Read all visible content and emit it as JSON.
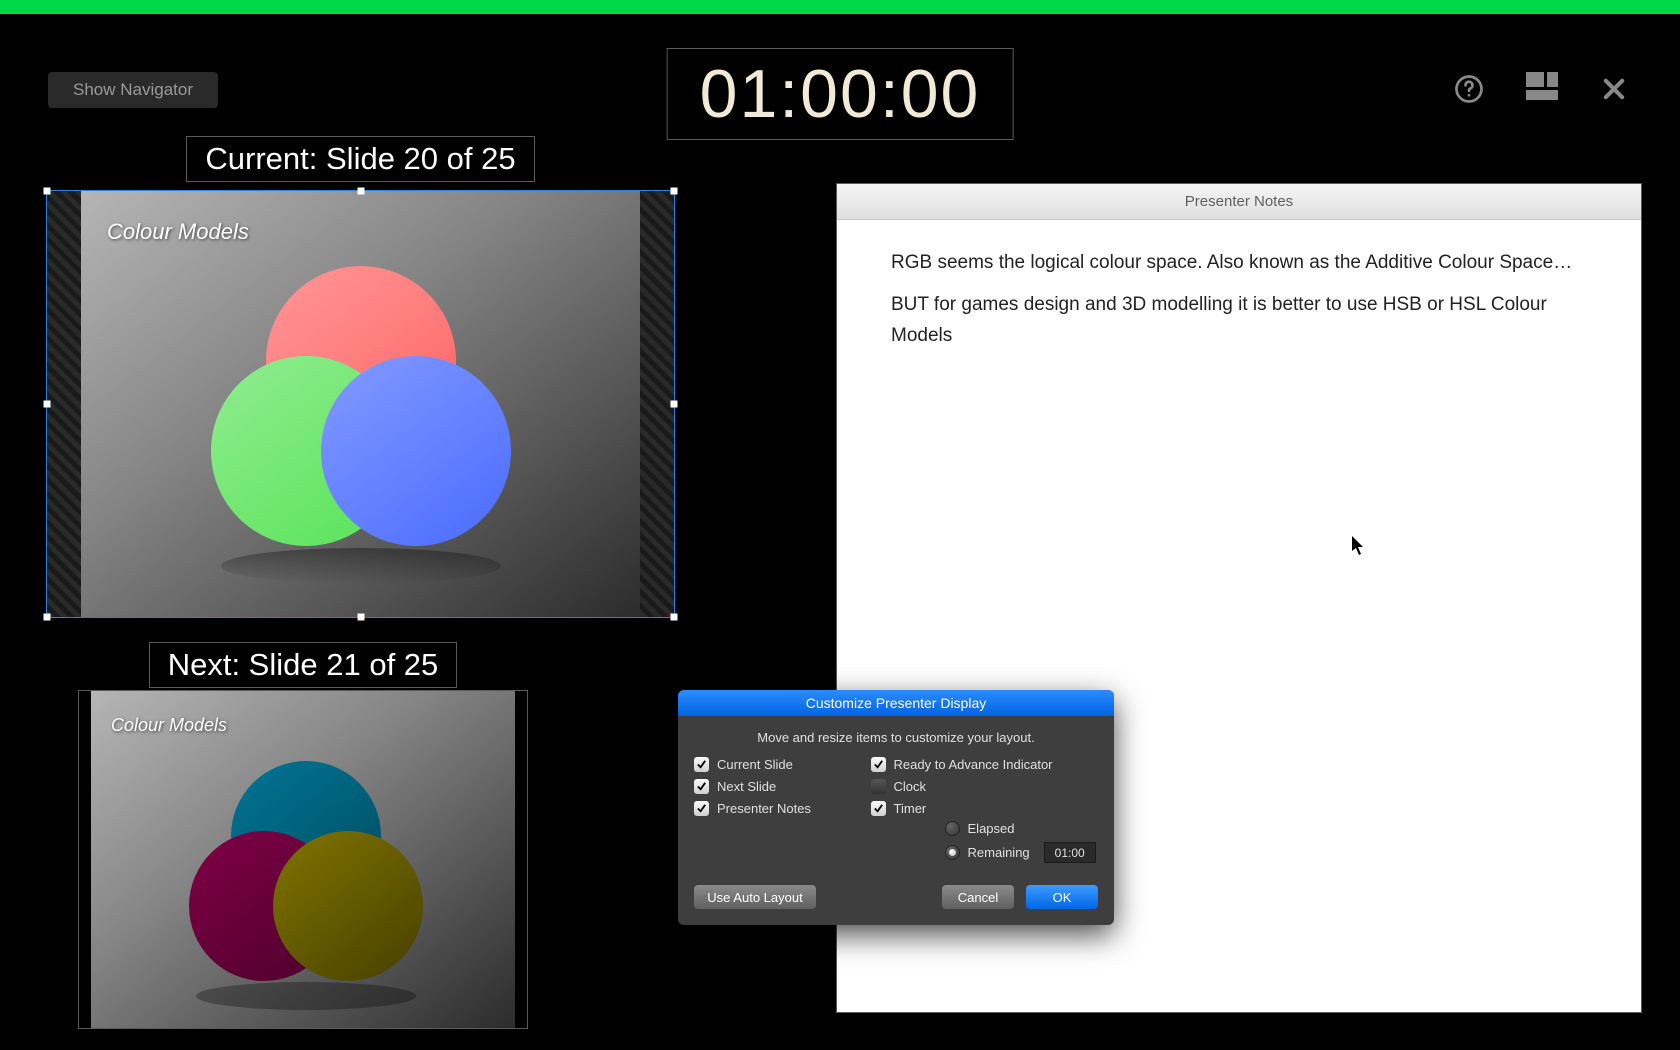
{
  "topbar": {
    "color": "#00d84a"
  },
  "buttons": {
    "show_navigator": "Show Navigator"
  },
  "timer": {
    "display": "01:00:00"
  },
  "slides": {
    "current_label": "Current: Slide 20 of 25",
    "next_label": "Next: Slide 21 of 25",
    "current_title": "Colour Models",
    "next_title": "Colour Models"
  },
  "notes": {
    "header": "Presenter Notes",
    "lines": [
      "RGB seems the logical colour space. Also known as the Additive Colour Space…",
      "BUT for games design and 3D modelling it is better to use HSB or HSL Colour Models"
    ]
  },
  "dialog": {
    "title": "Customize Presenter Display",
    "subtitle": "Move and resize items to customize your layout.",
    "opts": {
      "current_slide": {
        "label": "Current Slide",
        "checked": true
      },
      "next_slide": {
        "label": "Next Slide",
        "checked": true
      },
      "presenter_notes": {
        "label": "Presenter Notes",
        "checked": true
      },
      "ready_indicator": {
        "label": "Ready to Advance Indicator",
        "checked": true
      },
      "clock": {
        "label": "Clock",
        "checked": false
      },
      "timer": {
        "label": "Timer",
        "checked": true
      }
    },
    "timer_mode": {
      "elapsed": {
        "label": "Elapsed",
        "selected": false
      },
      "remaining": {
        "label": "Remaining",
        "selected": true
      },
      "value": "01:00"
    },
    "buttons": {
      "auto": "Use Auto Layout",
      "cancel": "Cancel",
      "ok": "OK"
    }
  },
  "icons": {
    "help": "help-icon",
    "layout": "layout-icon",
    "close": "close-icon"
  }
}
